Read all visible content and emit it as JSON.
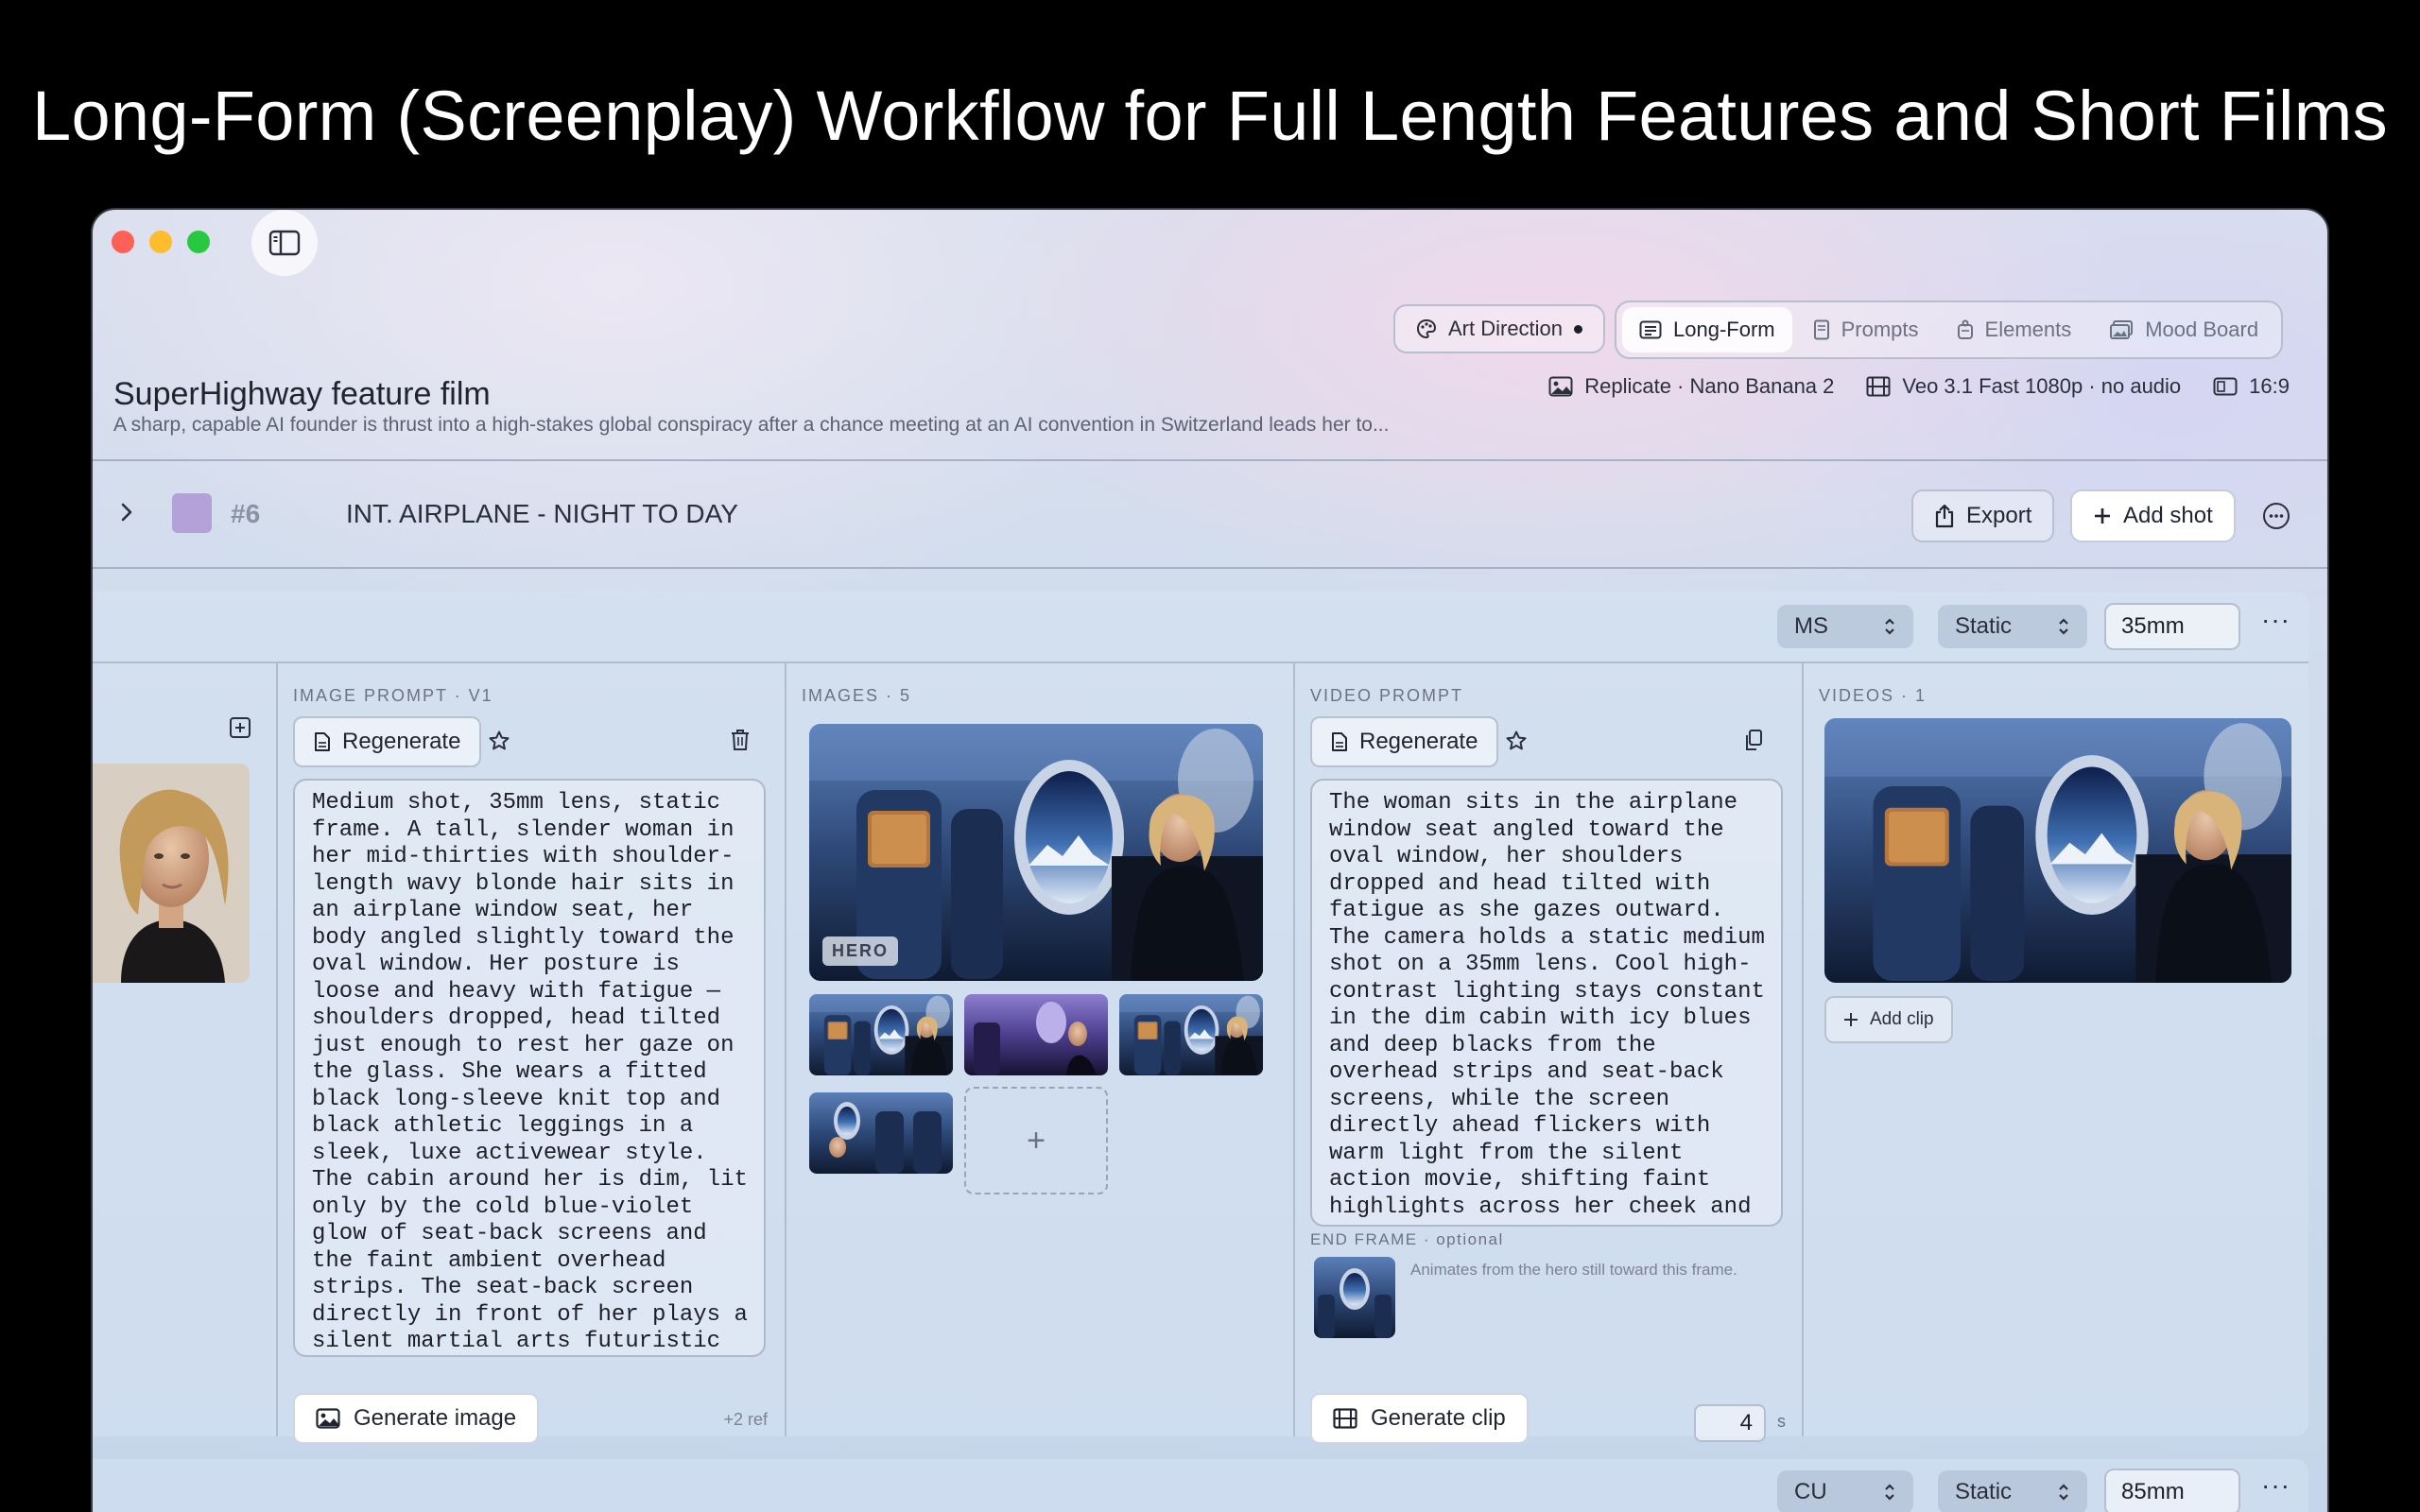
{
  "headline": "Long-Form (Screenplay) Workflow for Full Length Features and Short Films",
  "toolbar": {
    "art_direction": "Art Direction",
    "tabs": [
      {
        "label": "Long-Form",
        "icon": "document-icon",
        "active": true
      },
      {
        "label": "Prompts",
        "icon": "page-icon",
        "active": false
      },
      {
        "label": "Elements",
        "icon": "elements-icon",
        "active": false
      },
      {
        "label": "Mood Board",
        "icon": "photo-stack-icon",
        "active": false
      }
    ]
  },
  "project": {
    "title": "SuperHighway feature film",
    "description": "A sharp, capable AI founder is thrust into a high-stakes global conspiracy after a chance meeting at an AI convention in Switzerland leads her to...",
    "image_model": "Replicate · Nano Banana 2",
    "video_model": "Veo 3.1 Fast 1080p · no audio",
    "aspect": "16:9"
  },
  "scene": {
    "number": "#6",
    "title": "INT. AIRPLANE - NIGHT TO DAY",
    "swatch_color": "#b3a1d8",
    "export_label": "Export",
    "add_shot_label": "Add shot"
  },
  "shot": {
    "size": "MS",
    "movement": "Static",
    "lens": "35mm",
    "image_prompt_label": "IMAGE PROMPT · V1",
    "regenerate_label": "Regenerate",
    "image_prompt": "Medium shot, 35mm lens, static frame. A tall, slender woman in her mid-thirties with shoulder-length wavy blonde hair sits in an airplane window seat, her body angled slightly toward the oval window. Her posture is loose and heavy with fatigue — shoulders dropped, head tilted just enough to rest her gaze on the glass. She wears a fitted black long-sleeve knit top and black athletic leggings in a sleek, luxe activewear style. The cabin around her is dim, lit only by the cold blue-violet glow of seat-back screens and the faint ambient overhead strips. The seat-back screen directly in front of her plays a silent martial arts futuristic",
    "generate_image_label": "Generate image",
    "ref_count": "+2 ref",
    "images_label": "IMAGES · 5",
    "hero_tag": "HERO",
    "video_prompt_label": "VIDEO PROMPT",
    "video_prompt": "The woman sits in the airplane window seat angled toward the oval window, her shoulders dropped and head tilted with fatigue as she gazes outward. The camera holds a static medium shot on a 35mm lens. Cool high-contrast lighting stays constant in the dim cabin with icy blues and deep blacks from the overhead strips and seat-back screens, while the screen directly ahead flickers with warm light from the silent action movie, shifting faint highlights across her cheek and",
    "end_frame_label": "END FRAME · optional",
    "end_frame_note": "Animates from the hero still toward this frame.",
    "generate_clip_label": "Generate clip",
    "duration": "4",
    "duration_unit": "s",
    "videos_label": "VIDEOS · 1",
    "add_clip_label": "Add clip"
  },
  "next_shot": {
    "size": "CU",
    "movement": "Static",
    "lens": "85mm"
  }
}
